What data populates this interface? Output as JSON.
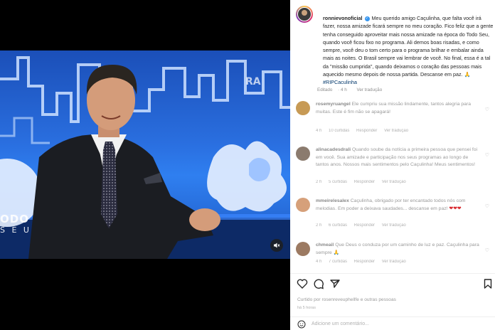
{
  "post": {
    "username": "ronnievonoficial",
    "verified_mark": "✓",
    "caption": "Meu querido amigo Caçulinha, que falta você irá fazer, nossa amizade ficará sempre no meu coração. Fico feliz que a gente tenha conseguido aproveitar mais nossa amizade na época do Todo Seu, quando você ficou fixo no programa. Ali demos boas risadas, e como sempre, você deu o tom certo para o programa brilhar e embalar ainda mais as noites. O Brasil sempre vai lembrar de você. No final, essa é a tal da \"missão cumprida\", quando deixamos o coração das pessoas mais aquecido mesmo depois de nossa partida. Descanse em paz. 🙏",
    "hashtag": "#RIPCaculinha",
    "edited": "Editado",
    "age": "4 h",
    "translate": "Ver tradução"
  },
  "video": {
    "logo_line1": "ODO",
    "logo_line2": "S E U",
    "watermark": "RA"
  },
  "comments": [
    {
      "user": "rosemyruangel",
      "text": "Ele cumpriu sua missão lindamente, tantos alegria para muitas. Este é fim não se apagará!",
      "time": "4 h",
      "likes": "10 curtidas",
      "reply": "Responder",
      "translate": "Ver tradução",
      "avatar_color": "#c79a55"
    },
    {
      "user": "alinacadesdrali",
      "text": "Quando soube da notícia a primeira pessoa que pensei foi em você. Sua amizade e participação nos seus programas ao longo de tantos anos. Nossos mais sentimentos pelo Caçulinha! Meus sentimentos!",
      "time": "2 h",
      "likes": "5 curtidas",
      "reply": "Responder",
      "translate": "Ver tradução",
      "avatar_color": "#8b7b6e"
    },
    {
      "user": "mmeirelesalex",
      "text": "Caçulinha, obrigado por ter encantado todos nós com melodias. Em poder a deixava saudades... descanse em paz!",
      "emoji": "❤❤❤",
      "time": "2 h",
      "likes": "6 curtidas",
      "reply": "Responder",
      "translate": "Ver tradução",
      "avatar_color": "#d6a07a"
    },
    {
      "user": "chmeail",
      "text": "Que Deus o conduza por um caminho de luz e paz. Caçulinha para sempre 🙏",
      "time": "4 h",
      "likes": "7 curtidas",
      "reply": "Responder",
      "translate": "Ver tradução",
      "avatar_color": "#9c7a62"
    }
  ],
  "footer": {
    "liked_by": "Curtido por rosenreveuphellfe e outras pessoas",
    "date": "há 5 horas",
    "comment_placeholder": "Adicione um comentário..."
  },
  "colors": {
    "verified": "#3897f0",
    "link": "#00376b",
    "video_blue": "#2a6fe0"
  }
}
